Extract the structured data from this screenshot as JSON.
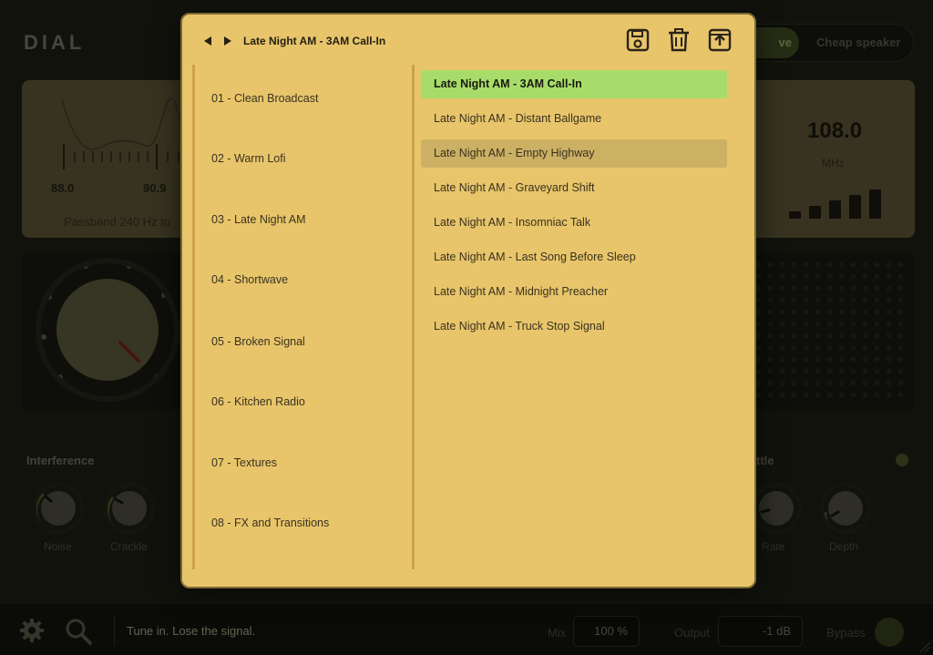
{
  "app": {
    "logo": "DIAL",
    "mode_active": "ve",
    "mode_inactive": "Cheap speaker"
  },
  "tuner": {
    "freq_a": "88.0",
    "freq_b": "90.9",
    "passband": "Passband 240 Hz to",
    "frequency": "108.0",
    "unit": "MHz",
    "signal_level": 5
  },
  "controls": {
    "interference_label": "Interference",
    "noise_label": "Noise",
    "crackle_label": "Crackle",
    "section_right_label": "ttle",
    "rate_label": "Rate",
    "depth_label": "Depth"
  },
  "footer": {
    "tagline": "Tune in. Lose the signal.",
    "mix_label": "Mix",
    "mix_value": "100 %",
    "output_label": "Output",
    "output_value": "-1 dB",
    "bypass_label": "Bypass"
  },
  "browser": {
    "current_preset": "Late Night AM - 3AM Call-In",
    "icons": {
      "prev": "triangle-left-icon",
      "next": "triangle-right-icon",
      "save": "save-icon",
      "delete": "trash-icon",
      "export": "export-icon"
    },
    "categories": [
      "01 - Clean Broadcast",
      "02 - Warm Lofi",
      "03 - Late Night AM",
      "04 - Shortwave",
      "05 - Broken Signal",
      "06 - Kitchen Radio",
      "07 - Textures",
      "08 - FX and Transitions"
    ],
    "presets": [
      "Late Night AM - 3AM Call-In",
      "Late Night AM - Distant Ballgame",
      "Late Night AM - Empty Highway",
      "Late Night AM - Graveyard Shift",
      "Late Night AM - Insomniac Talk",
      "Late Night AM - Last Song Before Sleep",
      "Late Night AM - Midnight Preacher",
      "Late Night AM - Truck Stop Signal"
    ],
    "selected_preset_index": 0,
    "hovered_preset_index": 2
  },
  "colors": {
    "modal_bg": "#e8c56a",
    "selected_bg": "#a8dc6a",
    "hover_bg": "#ccb063"
  }
}
